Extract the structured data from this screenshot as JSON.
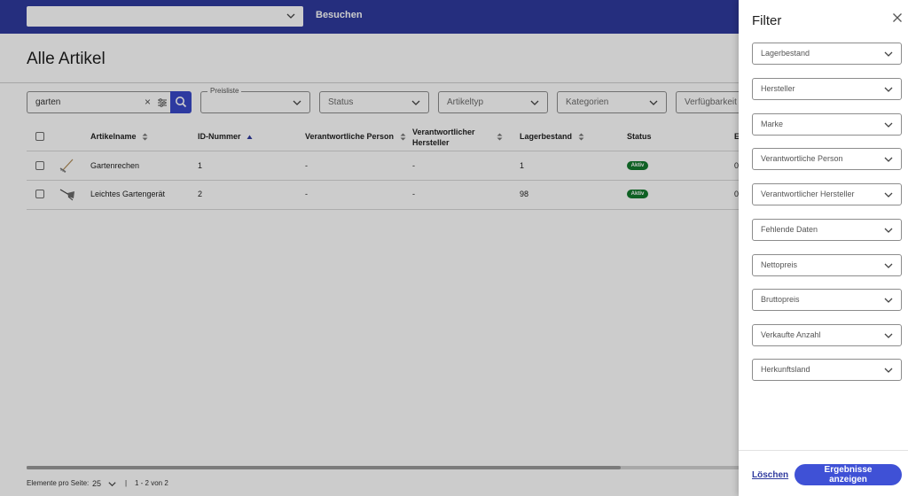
{
  "topbar": {
    "search_select_value": "",
    "search_button": "Besuchen"
  },
  "page": {
    "title": "Alle Artikel"
  },
  "search": {
    "value": "garten",
    "clear_glyph": "×"
  },
  "filters_bar": [
    {
      "floating_label": "Preisliste",
      "value": ""
    },
    {
      "label": "Status"
    },
    {
      "label": "Artikeltyp"
    },
    {
      "label": "Kategorien"
    },
    {
      "label": "Verfügbarkeit"
    }
  ],
  "table": {
    "columns": [
      "Artikelname",
      "ID-Nummer",
      "Verantwortliche Person",
      "Verantwortlicher",
      "Hersteller",
      "Lagerbestand",
      "Status",
      "E"
    ],
    "rows": [
      {
        "name": "Gartenrechen",
        "id": "1",
        "person": "-",
        "manufacturer": "-",
        "stock": "1",
        "status": "Aktiv",
        "extra": "0"
      },
      {
        "name": "Leichtes Gartengerät",
        "id": "2",
        "person": "-",
        "manufacturer": "-",
        "stock": "98",
        "status": "Aktiv",
        "extra": "0"
      }
    ]
  },
  "pagination": {
    "per_page_label": "Elemente pro Seite:",
    "per_page_value": "25",
    "separator": "|",
    "range": "1 - 2 von 2"
  },
  "filter_panel": {
    "title": "Filter",
    "fields": [
      "Lagerbestand",
      "Hersteller",
      "Marke",
      "Verantwortliche Person",
      "Verantwortlicher Hersteller",
      "Fehlende Daten",
      "Nettopreis",
      "Bruttopreis",
      "Verkaufte Anzahl",
      "Herkunftsland"
    ],
    "clear_button": "Löschen",
    "apply_button_line1": "Ergebnisse",
    "apply_button_line2": "anzeigen"
  },
  "colors": {
    "topbar": "#2f3a9e",
    "accent": "#3f51d6",
    "status_active": "#137a2e"
  }
}
